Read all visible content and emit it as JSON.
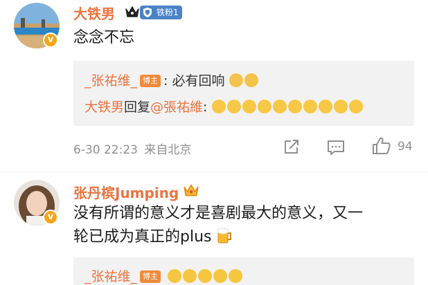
{
  "comments": [
    {
      "username": "大铁男",
      "fan_badge": "铁粉1",
      "text": "念念不忘",
      "reply_author": "_张祐维_",
      "reply_host_badge": "博主",
      "reply_text": ": 必有回响",
      "reply2_author": "大铁男",
      "reply2_mid": "回复",
      "reply2_mention": "@張祐維",
      "reply2_colon": ":",
      "time": "6-30 22:23",
      "location": "来自北京",
      "like_count": "94"
    },
    {
      "username": "张丹槟Jumping",
      "text_line1": "没有所谓的意义才是喜剧最大的意义，又一",
      "text_line2": "轮已成为真正的plus",
      "reply_author": "_张祐维_",
      "reply_host_badge": "博主"
    }
  ],
  "icons": [
    "verified-badge-icon",
    "crown-icon",
    "share-icon",
    "comment-icon",
    "like-icon",
    "beer-icon"
  ],
  "colors": {
    "username": "#eb7340",
    "badge_blue": "#4a82c8",
    "reply_bg": "#f2f2f2",
    "verified": "#f7a516"
  }
}
